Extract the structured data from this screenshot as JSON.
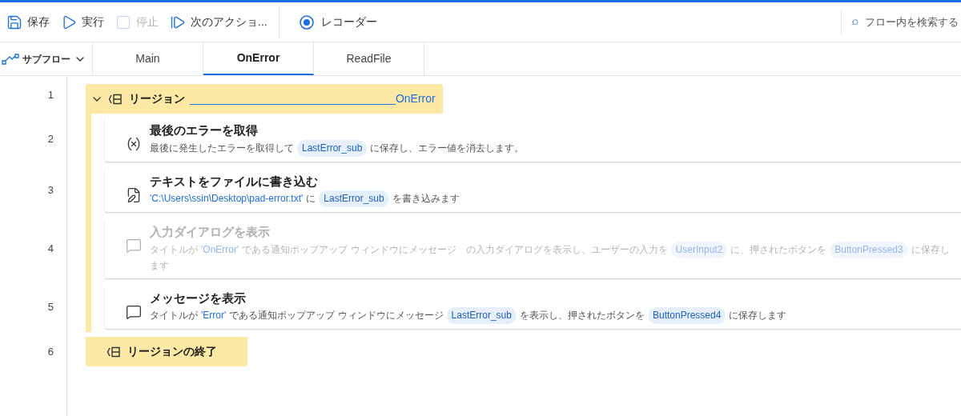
{
  "toolbar": {
    "buttons": [
      {
        "kind": "save",
        "label": "保存",
        "disabled": false
      },
      {
        "kind": "run",
        "label": "実行",
        "disabled": false
      },
      {
        "kind": "stop",
        "label": "停止",
        "disabled": true
      },
      {
        "kind": "next",
        "label": "次のアクショ...",
        "disabled": false
      },
      {
        "kind": "recorder",
        "label": "レコーダー",
        "disabled": false
      }
    ],
    "search": {
      "placeholder": "フロー内を検索する"
    }
  },
  "subflow_menu": {
    "label": "サブフロー"
  },
  "tabs": [
    {
      "label": "Main",
      "selected": false
    },
    {
      "label": "OnError",
      "selected": true
    },
    {
      "label": "ReadFile",
      "selected": false
    }
  ],
  "lines": [
    {
      "number": "1",
      "kind": "region_start",
      "label": "リージョン",
      "name": "_________________________________OnError",
      "expanded": true
    },
    {
      "number": "2",
      "kind": "get_error",
      "title": "最後のエラーを取得",
      "disabled": false,
      "description": [
        [
          {
            "kind": "text",
            "text": "最後に発生したエラーを取得して"
          },
          {
            "kind": "variable",
            "text": "LastError_sub"
          },
          {
            "kind": "text",
            "text": "に保存し、エラー値を消去します。"
          }
        ]
      ]
    },
    {
      "number": "3",
      "kind": "write_file",
      "title": "テキストをファイルに書き込む",
      "disabled": false,
      "description": [
        [
          {
            "kind": "literal",
            "text": "'C:\\Users\\ssin\\Desktop\\pad-error.txt'"
          },
          {
            "kind": "text",
            "text": "に"
          },
          {
            "kind": "variable",
            "text": "LastError_sub"
          },
          {
            "kind": "text",
            "text": "を書き込みます"
          }
        ]
      ]
    },
    {
      "number": "4",
      "kind": "input_dialog",
      "title": "入力ダイアログを表示",
      "disabled": true,
      "description": [
        [
          {
            "kind": "text",
            "text": "タイトルが"
          },
          {
            "kind": "literal",
            "text": "'OnError'"
          },
          {
            "kind": "text",
            "text": "である通知ポップアップ ウィンドウにメッセージ　の入力ダイアログを表示し、ユーザーの入力を"
          },
          {
            "kind": "variable",
            "text": "UserInput2"
          },
          {
            "kind": "text",
            "text": "に、押されたボタンを"
          },
          {
            "kind": "variable",
            "text": "ButtonPressed3"
          },
          {
            "kind": "text",
            "text": "に保存し"
          }
        ],
        [
          {
            "kind": "text",
            "text": "ます"
          }
        ]
      ]
    },
    {
      "number": "5",
      "kind": "message",
      "title": "メッセージを表示",
      "disabled": false,
      "description": [
        [
          {
            "kind": "text",
            "text": "タイトルが"
          },
          {
            "kind": "literal",
            "text": "'Error'"
          },
          {
            "kind": "text",
            "text": "である通知ポップアップ ウィンドウにメッセージ"
          },
          {
            "kind": "variable",
            "text": "LastError_sub"
          },
          {
            "kind": "text",
            "text": "を表示し、押されたボタンを"
          },
          {
            "kind": "variable",
            "text": "ButtonPressed4"
          },
          {
            "kind": "text",
            "text": "に保存します"
          }
        ]
      ]
    },
    {
      "number": "6",
      "kind": "region_end",
      "label": "リージョンの終了"
    }
  ]
}
